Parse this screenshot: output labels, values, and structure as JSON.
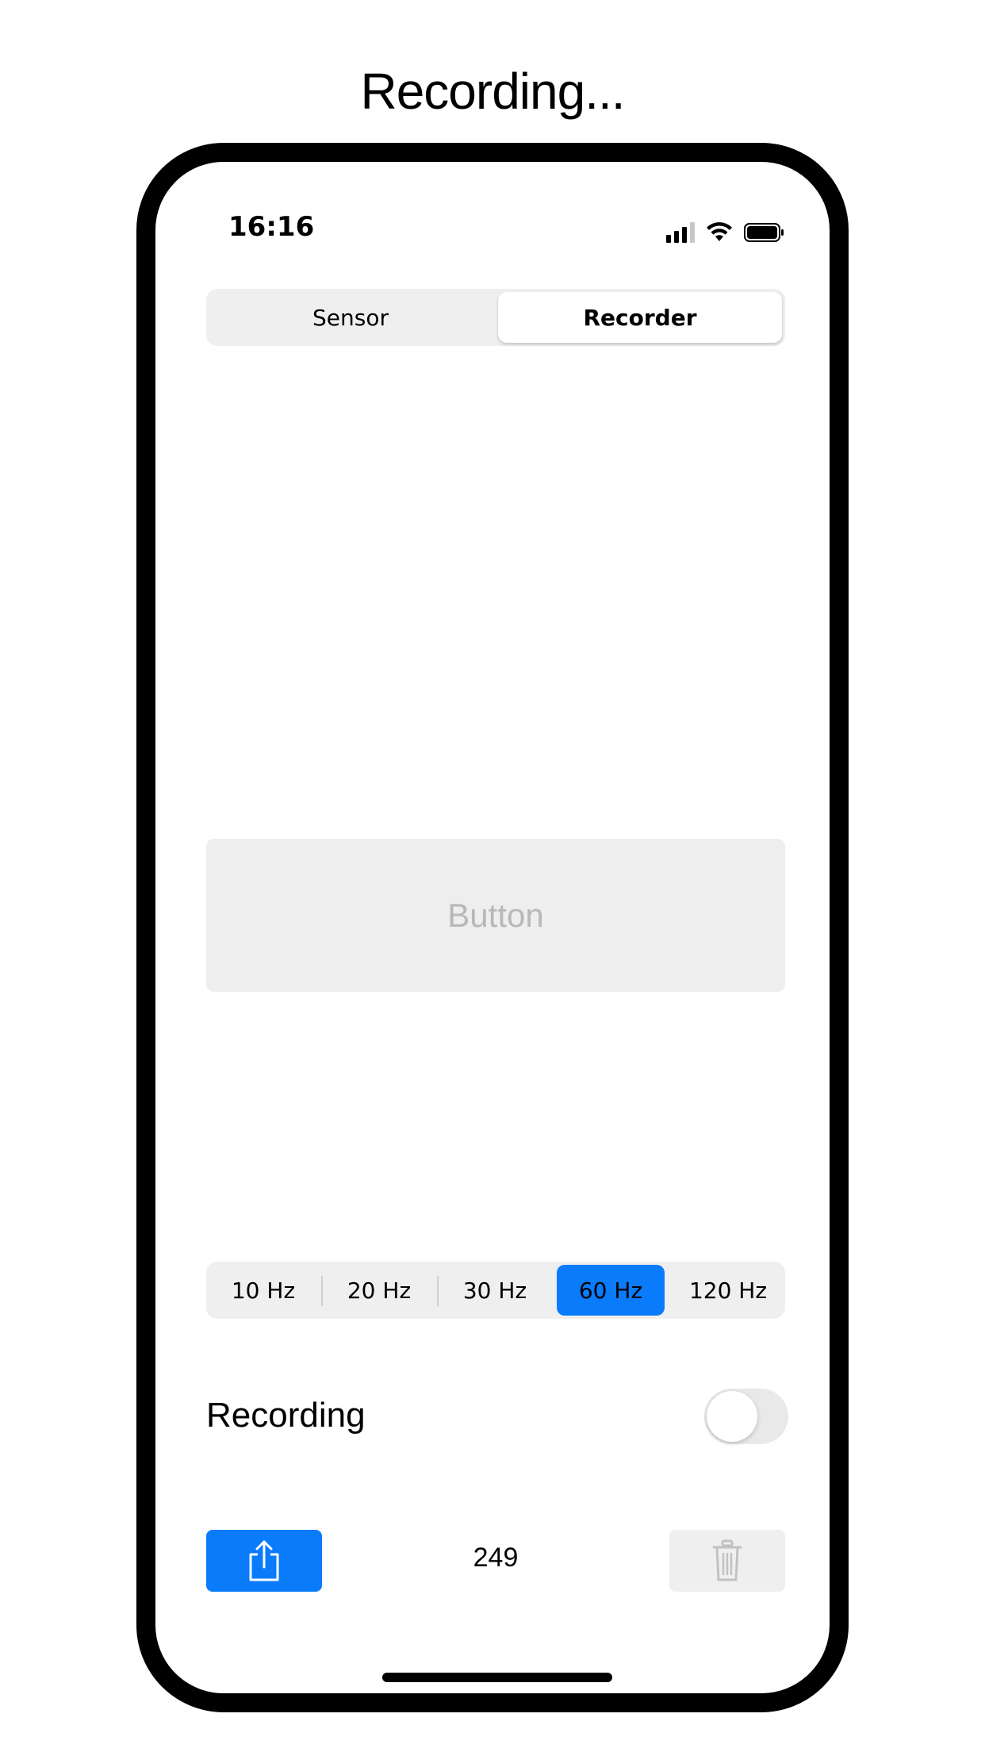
{
  "caption": "Recording...",
  "status_bar": {
    "time": "16:16",
    "icons": [
      "cellular-signal-icon",
      "wifi-icon",
      "battery-icon"
    ]
  },
  "top_segment": {
    "items": [
      "Sensor",
      "Recorder"
    ],
    "selected": "Recorder"
  },
  "main_button": {
    "label": "Button"
  },
  "frequency_segment": {
    "items": [
      "10 Hz",
      "20 Hz",
      "30 Hz",
      "60 Hz",
      "120 Hz"
    ],
    "selected": "60 Hz"
  },
  "recording": {
    "label": "Recording",
    "toggle_on": false
  },
  "bottom_bar": {
    "count": "249",
    "share_icon": "share-icon",
    "trash_icon": "trash-icon"
  },
  "colors": {
    "accent": "#0a7bfb",
    "segment_bg": "#efefef",
    "disabled_text": "#b8b8b8"
  }
}
